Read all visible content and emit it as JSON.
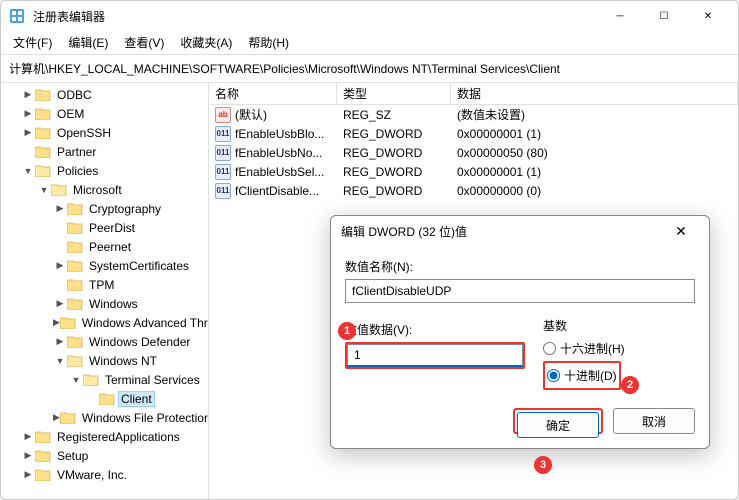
{
  "window": {
    "title": "注册表编辑器"
  },
  "menu": {
    "file": "文件(F)",
    "edit": "编辑(E)",
    "view": "查看(V)",
    "fav": "收藏夹(A)",
    "help": "帮助(H)"
  },
  "address": "计算机\\HKEY_LOCAL_MACHINE\\SOFTWARE\\Policies\\Microsoft\\Windows NT\\Terminal Services\\Client",
  "tree": [
    {
      "indent": 1,
      "arrow": "▶",
      "label": "ODBC"
    },
    {
      "indent": 1,
      "arrow": "▶",
      "label": "OEM"
    },
    {
      "indent": 1,
      "arrow": "▶",
      "label": "OpenSSH"
    },
    {
      "indent": 1,
      "arrow": "",
      "label": "Partner"
    },
    {
      "indent": 1,
      "arrow": "▼",
      "label": "Policies"
    },
    {
      "indent": 2,
      "arrow": "▼",
      "label": "Microsoft"
    },
    {
      "indent": 3,
      "arrow": "▶",
      "label": "Cryptography"
    },
    {
      "indent": 3,
      "arrow": "",
      "label": "PeerDist"
    },
    {
      "indent": 3,
      "arrow": "",
      "label": "Peernet"
    },
    {
      "indent": 3,
      "arrow": "▶",
      "label": "SystemCertificates"
    },
    {
      "indent": 3,
      "arrow": "",
      "label": "TPM"
    },
    {
      "indent": 3,
      "arrow": "▶",
      "label": "Windows"
    },
    {
      "indent": 3,
      "arrow": "▶",
      "label": "Windows Advanced Threat Protection"
    },
    {
      "indent": 3,
      "arrow": "▶",
      "label": "Windows Defender"
    },
    {
      "indent": 3,
      "arrow": "▼",
      "label": "Windows NT"
    },
    {
      "indent": 4,
      "arrow": "▼",
      "label": "Terminal Services"
    },
    {
      "indent": 5,
      "arrow": "",
      "label": "Client",
      "selected": true
    },
    {
      "indent": 3,
      "arrow": "▶",
      "label": "Windows File Protection"
    },
    {
      "indent": 1,
      "arrow": "▶",
      "label": "RegisteredApplications"
    },
    {
      "indent": 1,
      "arrow": "▶",
      "label": "Setup"
    },
    {
      "indent": 1,
      "arrow": "▶",
      "label": "VMware, Inc."
    }
  ],
  "cols": {
    "name": "名称",
    "type": "类型",
    "data": "数据"
  },
  "rows": [
    {
      "icon": "str",
      "name": "(默认)",
      "type": "REG_SZ",
      "data": "(数值未设置)"
    },
    {
      "icon": "bin",
      "name": "fEnableUsbBlo...",
      "type": "REG_DWORD",
      "data": "0x00000001 (1)"
    },
    {
      "icon": "bin",
      "name": "fEnableUsbNo...",
      "type": "REG_DWORD",
      "data": "0x00000050 (80)"
    },
    {
      "icon": "bin",
      "name": "fEnableUsbSel...",
      "type": "REG_DWORD",
      "data": "0x00000001 (1)"
    },
    {
      "icon": "bin",
      "name": "fClientDisable...",
      "type": "REG_DWORD",
      "data": "0x00000000 (0)"
    }
  ],
  "dialog": {
    "title": "编辑 DWORD (32 位)值",
    "name_label": "数值名称(N):",
    "name_value": "fClientDisableUDP",
    "data_label": "数值数据(V):",
    "data_value": "1",
    "base_label": "基数",
    "hex": "十六进制(H)",
    "dec": "十进制(D)",
    "ok": "确定",
    "cancel": "取消"
  },
  "icon_text": {
    "str": "ab",
    "bin": "011"
  }
}
